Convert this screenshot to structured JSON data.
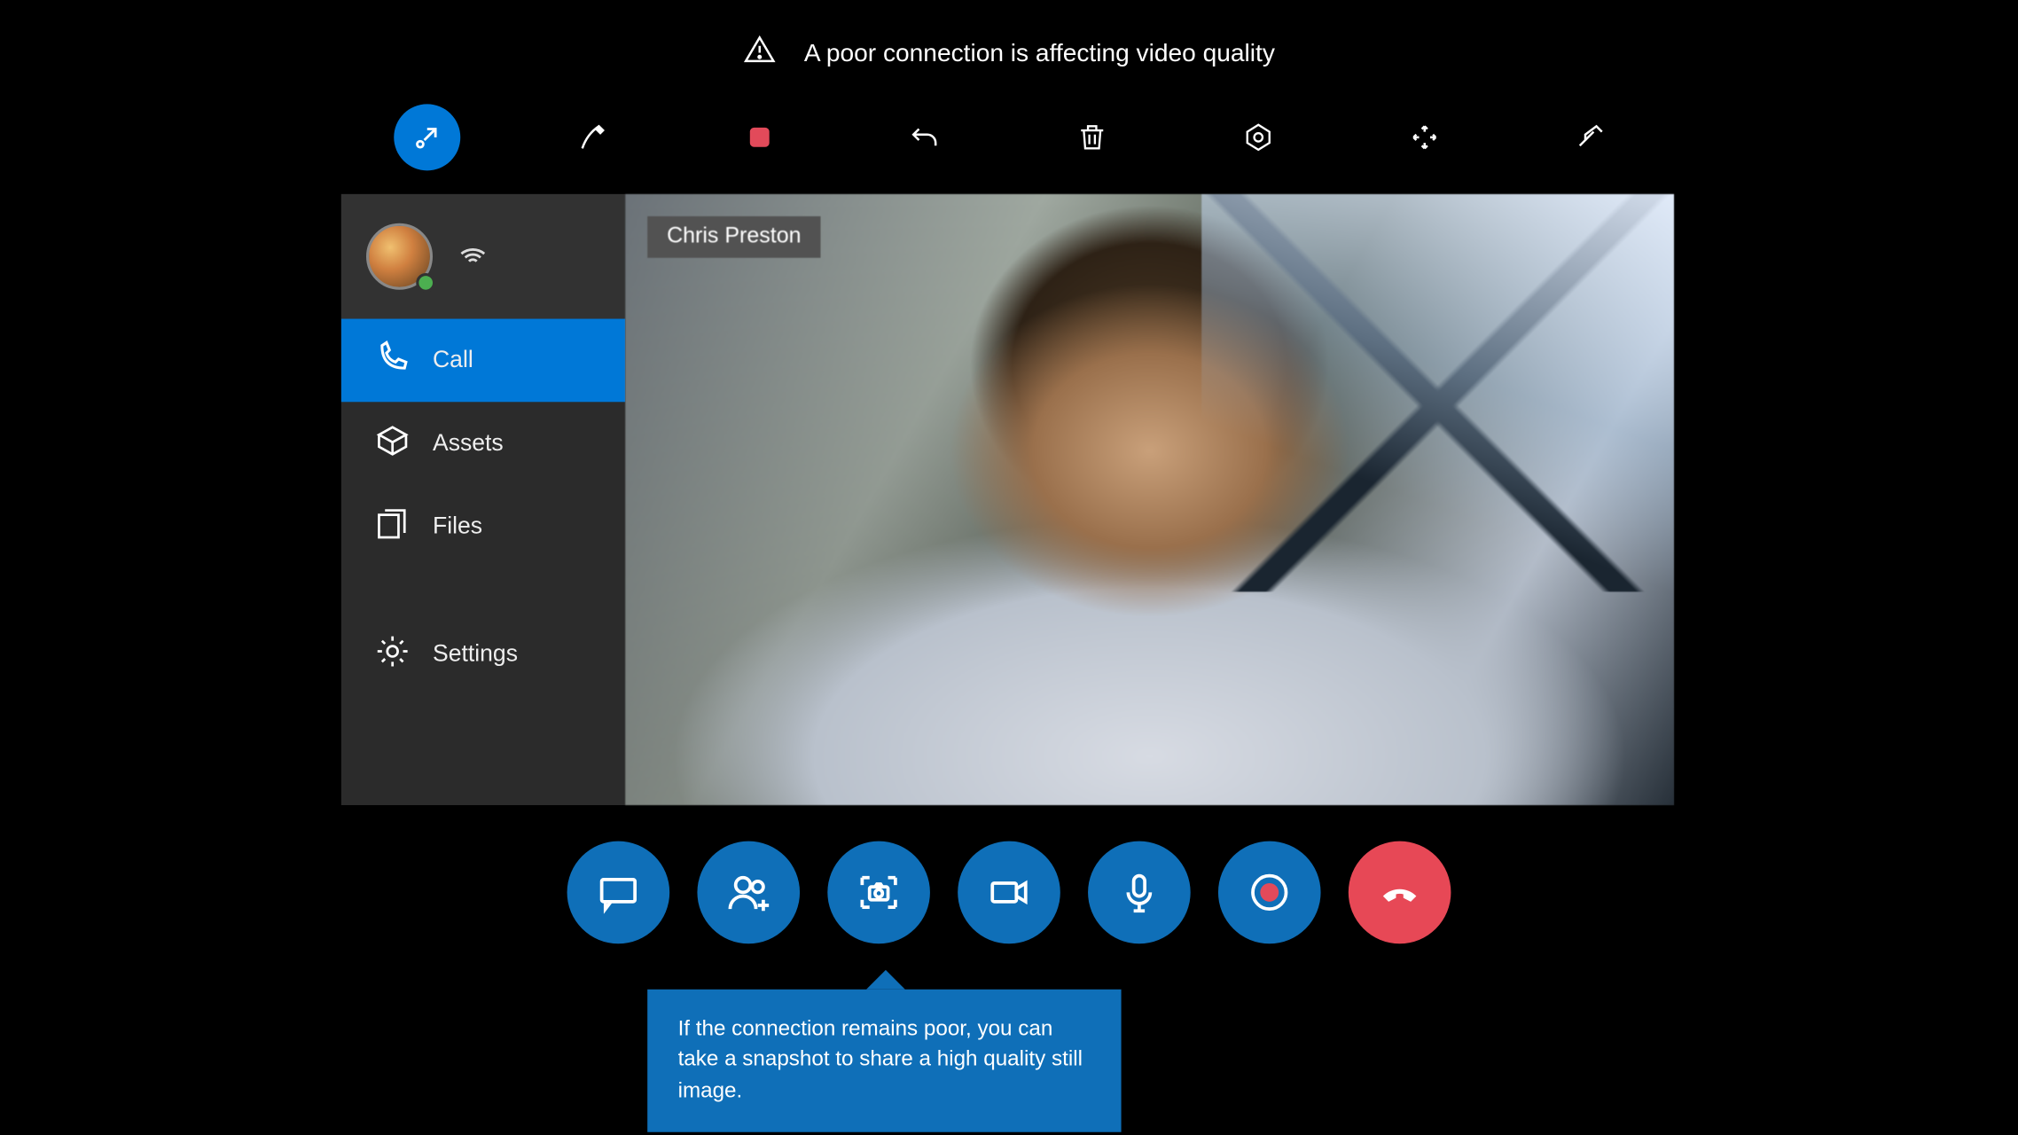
{
  "warning": {
    "text": "A poor connection is affecting video quality"
  },
  "toolbar": {
    "icons": [
      "pointer-collapse",
      "pen",
      "stop-record",
      "undo",
      "trash",
      "shape",
      "expand",
      "pin"
    ]
  },
  "sidebar": {
    "items": [
      {
        "icon": "phone",
        "label": "Call",
        "active": true
      },
      {
        "icon": "box",
        "label": "Assets",
        "active": false
      },
      {
        "icon": "files",
        "label": "Files",
        "active": false
      },
      {
        "icon": "gear",
        "label": "Settings",
        "active": false
      }
    ]
  },
  "video": {
    "participant_name": "Chris Preston"
  },
  "call_controls": {
    "buttons": [
      "chat",
      "add-participant",
      "snapshot",
      "video",
      "mic",
      "record",
      "hangup"
    ]
  },
  "tooltip": {
    "text": "If the connection remains poor, you can take a snapshot to share a high quality still image."
  },
  "colors": {
    "accent": "#0f6fb8",
    "hangup": "#e74856",
    "sidebar_bg": "#2b2b2b",
    "sidebar_header_bg": "#323232"
  }
}
